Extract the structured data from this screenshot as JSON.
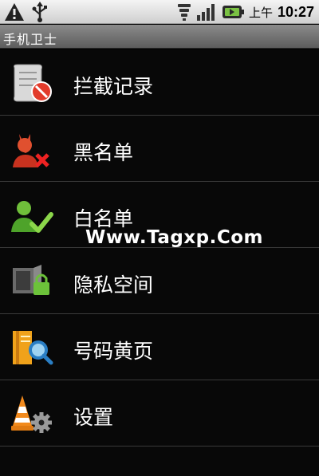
{
  "status_bar": {
    "ampm": "上午",
    "time": "10:27",
    "icons": [
      "warning-icon",
      "usb-icon",
      "wifi-icon",
      "signal-icon",
      "battery-icon"
    ]
  },
  "title_bar": {
    "title": "手机卫士"
  },
  "menu": {
    "items": [
      {
        "label": "拦截记录",
        "icon": "blocked-log-icon"
      },
      {
        "label": "黑名单",
        "icon": "blacklist-icon"
      },
      {
        "label": "白名单",
        "icon": "whitelist-icon"
      },
      {
        "label": "隐私空间",
        "icon": "private-space-icon"
      },
      {
        "label": "号码黄页",
        "icon": "yellow-pages-icon"
      },
      {
        "label": "设置",
        "icon": "settings-icon"
      }
    ]
  },
  "watermark": {
    "text": "Www.Tagxp.Com"
  }
}
